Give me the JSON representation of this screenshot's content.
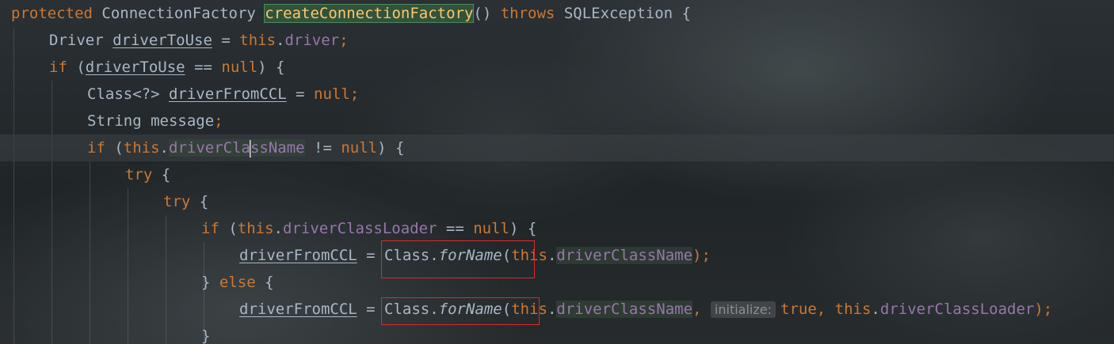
{
  "editor": {
    "inlay_hint": "initialize:",
    "lines": [
      {
        "p": [
          "protected",
          " ConnectionFactory ",
          "createConnectionFactory",
          "() ",
          "throws",
          " SQLException {"
        ]
      },
      {
        "p": [
          "Driver ",
          "driverToUse",
          " = ",
          "this",
          ".",
          "driver",
          ";"
        ]
      },
      {
        "p": [
          "if",
          " (",
          "driverToUse",
          " == ",
          "null",
          ") {"
        ]
      },
      {
        "p": [
          "Class<?> ",
          "driverFromCCL",
          " = ",
          "null",
          ";"
        ]
      },
      {
        "p": [
          "String message",
          ";"
        ]
      },
      {
        "p": [
          "if",
          " (",
          "this",
          ".",
          "driverCla",
          "ssName",
          " != ",
          "null",
          ") {"
        ]
      },
      {
        "p": [
          "try",
          " {"
        ]
      },
      {
        "p": [
          "try",
          " {"
        ]
      },
      {
        "p": [
          "if",
          " (",
          "this",
          ".",
          "driverClassLoader",
          " == ",
          "null",
          ") {"
        ]
      },
      {
        "p": [
          "driverFromCCL",
          " = Class.",
          "forName",
          "(",
          "this",
          ".",
          "driverClassName",
          ");"
        ]
      },
      {
        "p": [
          "} ",
          "else",
          " {"
        ]
      },
      {
        "p": [
          "driverFromCCL",
          " = Class.",
          "forName",
          "(",
          "this",
          ".",
          "driverClassName",
          ",",
          " ",
          "true",
          ", ",
          "this",
          ".",
          "driverClassLoader",
          ");"
        ]
      },
      {
        "p": [
          "}"
        ]
      }
    ]
  },
  "colors": {
    "keyword": "#cc7832",
    "field": "#9876aa",
    "method_declaration": "#ffc66d",
    "default_text": "#a9b7c6",
    "annotation_box": "#e02828"
  }
}
